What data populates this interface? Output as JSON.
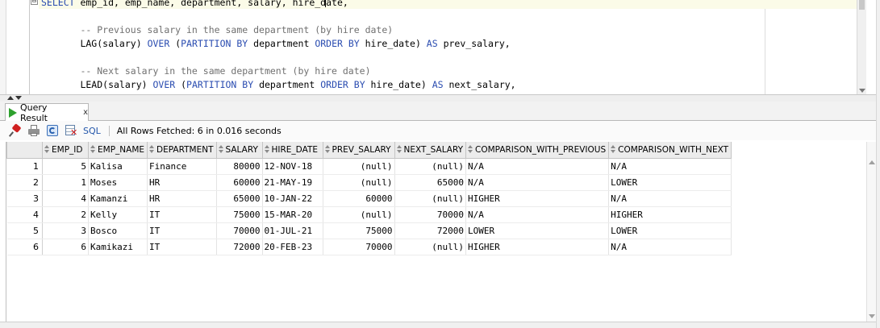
{
  "editor": {
    "fold_marker": "⊟",
    "lines": [
      {
        "parts": [
          {
            "t": "SELECT",
            "c": "kw"
          },
          {
            "t": " emp_id, emp_name, department, salary, hire_d"
          },
          {
            "t": "|",
            "c": "caret"
          },
          {
            "t": "ate,"
          }
        ]
      },
      {
        "parts": []
      },
      {
        "parts": [
          {
            "t": "       -- Previous salary in the same department (by hire date)",
            "c": "cm"
          }
        ]
      },
      {
        "parts": [
          {
            "t": "       LAG(salary) "
          },
          {
            "t": "OVER",
            "c": "kw"
          },
          {
            "t": " ("
          },
          {
            "t": "PARTITION BY",
            "c": "kw"
          },
          {
            "t": " department "
          },
          {
            "t": "ORDER BY",
            "c": "kw"
          },
          {
            "t": " hire_date) "
          },
          {
            "t": "AS",
            "c": "kw"
          },
          {
            "t": " prev_salary,"
          }
        ]
      },
      {
        "parts": []
      },
      {
        "parts": [
          {
            "t": "       -- Next salary in the same department (by hire date)",
            "c": "cm"
          }
        ]
      },
      {
        "parts": [
          {
            "t": "       LEAD(salary) "
          },
          {
            "t": "OVER",
            "c": "kw"
          },
          {
            "t": " ("
          },
          {
            "t": "PARTITION BY",
            "c": "kw"
          },
          {
            "t": " department "
          },
          {
            "t": "ORDER BY",
            "c": "kw"
          },
          {
            "t": " hire_date) "
          },
          {
            "t": "AS",
            "c": "kw"
          },
          {
            "t": " next_salary,"
          }
        ]
      }
    ]
  },
  "result_tab": {
    "label": "Query Result",
    "close": "x"
  },
  "toolbar": {
    "sql_label": "SQL",
    "status": "All Rows Fetched: 6 in 0.016 seconds"
  },
  "grid": {
    "columns": [
      "EMP_ID",
      "EMP_NAME",
      "DEPARTMENT",
      "SALARY",
      "HIRE_DATE",
      "PREV_SALARY",
      "NEXT_SALARY",
      "COMPARISON_WITH_PREVIOUS",
      "COMPARISON_WITH_NEXT"
    ],
    "rows": [
      {
        "n": "1",
        "cells": [
          "5",
          "Kalisa",
          "Finance",
          "80000",
          "12-NOV-18",
          "(null)",
          "(null)",
          "N/A",
          "N/A"
        ]
      },
      {
        "n": "2",
        "cells": [
          "1",
          "Moses",
          "HR",
          "60000",
          "21-MAY-19",
          "(null)",
          "65000",
          "N/A",
          "LOWER"
        ]
      },
      {
        "n": "3",
        "cells": [
          "4",
          "Kamanzi",
          "HR",
          "65000",
          "10-JAN-22",
          "60000",
          "(null)",
          "HIGHER",
          "N/A"
        ]
      },
      {
        "n": "4",
        "cells": [
          "2",
          "Kelly",
          "IT",
          "75000",
          "15-MAR-20",
          "(null)",
          "70000",
          "N/A",
          "HIGHER"
        ]
      },
      {
        "n": "5",
        "cells": [
          "3",
          "Bosco",
          "IT",
          "70000",
          "01-JUL-21",
          "75000",
          "72000",
          "LOWER",
          "LOWER"
        ]
      },
      {
        "n": "6",
        "cells": [
          "6",
          "Kamikazi",
          "IT",
          "72000",
          "20-FEB-23",
          "70000",
          "(null)",
          "HIGHER",
          "N/A"
        ]
      }
    ]
  }
}
